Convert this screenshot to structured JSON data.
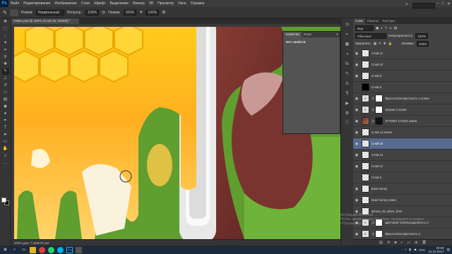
{
  "app": {
    "logo": "Ps"
  },
  "menu": [
    "Файл",
    "Редактирование",
    "Изображение",
    "Слои",
    "Шрифт",
    "Выделение",
    "Фильтр",
    "3D",
    "Просмотр",
    "Окно",
    "Справка"
  ],
  "window_controls": {
    "minimize": "–",
    "maximize": "□",
    "close": "✕"
  },
  "options": {
    "mode_label": "Режим:",
    "mode_value": "Нормальный",
    "opacity_label": "Непрозр.:",
    "opacity_value": "100%",
    "flow_label": "Нажим:",
    "flow_value": "100%",
    "smoothing_value": "100%"
  },
  "document": {
    "tab_title": "rratam.psd @ 400% (Слой 15, RGB/8) *",
    "status": "400%     Док: 7,46M/76,1M"
  },
  "properties": {
    "tab_properties": "Свойства",
    "tab_info": "Инфо",
    "body": "Нет свойств"
  },
  "layers_panel": {
    "tabs": [
      "Слои",
      "Каналы",
      "Контуры"
    ],
    "kind_label": "Вид",
    "blend_mode": "Обычные",
    "opacity_label": "Непрозрачность:",
    "opacity_value": "100%",
    "lock_label": "Закрепить:",
    "fill_label": "Заливка:",
    "fill_value": "100%",
    "layers": [
      {
        "name": "Слой 11",
        "thumb": "checker",
        "visible": true
      },
      {
        "name": "Слой 10",
        "thumb": "checker",
        "visible": true
      },
      {
        "name": "Слой 8",
        "thumb": "checker",
        "visible": true
      },
      {
        "name": "Слой 6",
        "thumb": "black",
        "visible": false
      },
      {
        "name": "Яркость/Контрастность 1 копия",
        "thumb": "adj",
        "visible": true
      },
      {
        "name": "Уровни 1 копия",
        "thumb": "adj",
        "visible": true
      },
      {
        "name": "1F70252 171634 копия",
        "thumb": "photo",
        "visible": true
      },
      {
        "name": "Слой 13 копия",
        "thumb": "checker",
        "visible": true
      },
      {
        "name": "Слой 15",
        "thumb": "checker",
        "visible": true,
        "selected": true
      },
      {
        "name": "Слой 14",
        "thumb": "checker",
        "visible": true
      },
      {
        "name": "Слой 12",
        "thumb": "checker",
        "visible": true
      },
      {
        "name": "Слой 5",
        "thumb": "checker",
        "visible": false
      },
      {
        "name": "base honey",
        "thumb": "checker",
        "visible": true
      },
      {
        "name": "base honey копия",
        "thumb": "checker",
        "visible": true
      },
      {
        "name": "iphone_6s_silver_front",
        "thumb": "checker",
        "visible": true
      },
      {
        "name": "Цветовой тон/Насыщенность 2",
        "thumb": "adj",
        "visible": true
      },
      {
        "name": "Яркость/Контрастность 2",
        "thumb": "adj",
        "visible": true
      }
    ]
  },
  "taskbar": {
    "lang": "РУС",
    "time": "20:00",
    "date": "12.10.2017"
  },
  "watermark": {
    "line1": "Активация Windows",
    "line2": "Чтобы активировать Windows, перейдите в раздел",
    "line3": "«Параметры»."
  }
}
